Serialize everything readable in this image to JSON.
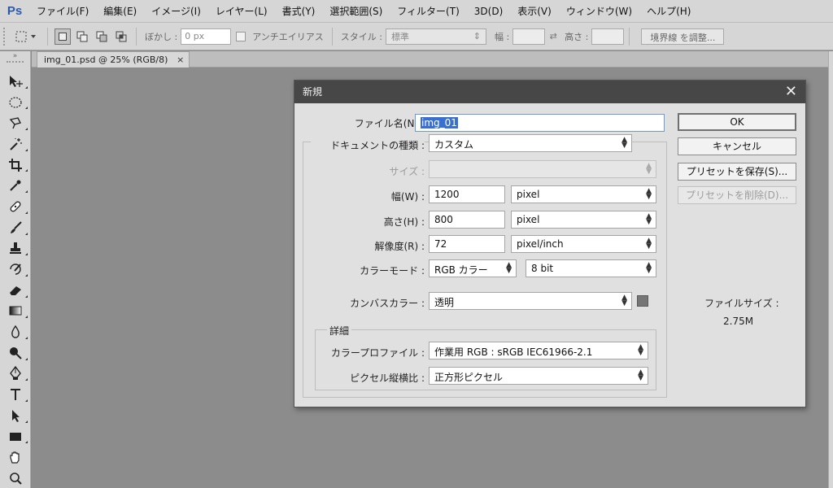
{
  "app": {
    "logo": "Ps"
  },
  "menu": [
    "ファイル(F)",
    "編集(E)",
    "イメージ(I)",
    "レイヤー(L)",
    "書式(Y)",
    "選択範囲(S)",
    "フィルター(T)",
    "3D(D)",
    "表示(V)",
    "ウィンドウ(W)",
    "ヘルプ(H)"
  ],
  "options": {
    "feather_label": "ぼかし :",
    "feather_value": "0 px",
    "antialias_label": "アンチエイリアス",
    "style_label": "スタイル :",
    "style_value": "標準",
    "width_label": "幅 :",
    "height_label": "高さ :",
    "refine_button": "境界線 を調整..."
  },
  "tab": {
    "title": "img_01.psd @ 25% (RGB/8)",
    "close": "×"
  },
  "dialog": {
    "title": "新規",
    "close": "✕",
    "name_label": "ファイル名(N) :",
    "name_value": "img_01",
    "doctype_label": "ドキュメントの種類 :",
    "doctype_value": "カスタム",
    "size_label": "サイズ :",
    "size_value": "",
    "width_label": "幅(W) :",
    "width_value": "1200",
    "width_unit": "pixel",
    "height_label": "高さ(H) :",
    "height_value": "800",
    "height_unit": "pixel",
    "resolution_label": "解像度(R) :",
    "resolution_value": "72",
    "resolution_unit": "pixel/inch",
    "colormode_label": "カラーモード :",
    "colormode_value": "RGB カラー",
    "bitdepth_value": "8 bit",
    "canvas_label": "カンバスカラー :",
    "canvas_value": "透明",
    "canvas_swatch_color": "#767676",
    "advanced_label": "詳細",
    "profile_label": "カラープロファイル :",
    "profile_value": "作業用 RGB :  sRGB IEC61966-2.1",
    "aspect_label": "ピクセル縦横比 :",
    "aspect_value": "正方形ピクセル",
    "ok": "OK",
    "cancel": "キャンセル",
    "save_preset": "プリセットを保存(S)...",
    "delete_preset": "プリセットを削除(D)...",
    "filesize_label": "ファイルサイズ :",
    "filesize_value": "2.75M"
  },
  "tools": [
    "move-icon",
    "marquee-icon",
    "lasso-icon",
    "magic-wand-icon",
    "crop-icon",
    "eyedropper-icon",
    "healing-brush-icon",
    "brush-icon",
    "clone-stamp-icon",
    "history-brush-icon",
    "eraser-icon",
    "gradient-icon",
    "blur-icon",
    "dodge-icon",
    "pen-icon",
    "type-icon",
    "path-select-icon",
    "rectangle-icon",
    "hand-icon",
    "zoom-icon"
  ]
}
